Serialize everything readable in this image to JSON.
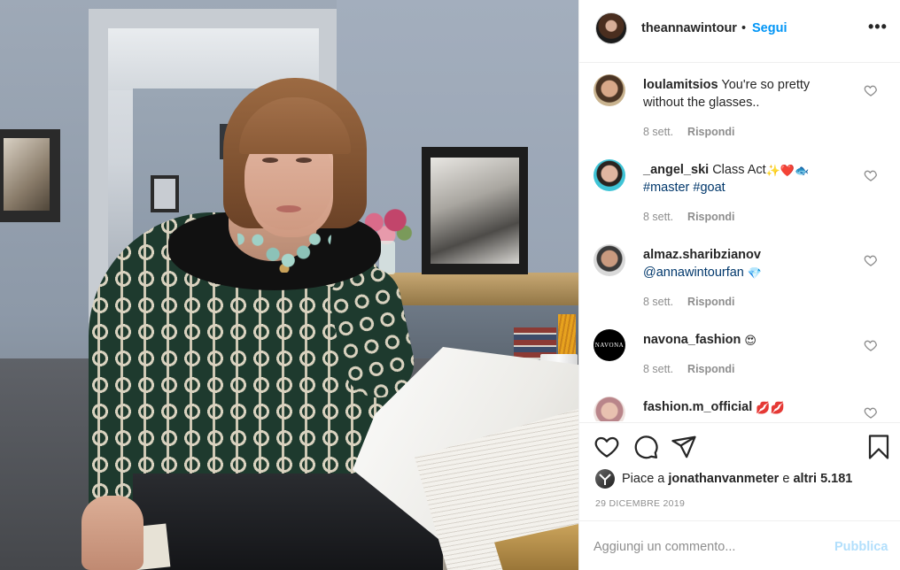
{
  "post": {
    "author": "theannawintour",
    "separator": "•",
    "follow_label": "Segui",
    "more_label": "•••"
  },
  "comments": [
    {
      "user": "loulamitsios",
      "text": "You're so pretty without the glasses..",
      "time": "8 sett.",
      "reply_label": "Rispondi"
    },
    {
      "user": "_angel_ski",
      "text": "Class Act",
      "emojis": "✨❤️🐟",
      "tags": [
        "#master",
        "#goat"
      ],
      "time": "8 sett.",
      "reply_label": "Rispondi"
    },
    {
      "user": "almaz.sharibzianov",
      "mention": "@annawintourfan",
      "emojis": "💎",
      "time": "8 sett.",
      "reply_label": "Rispondi"
    },
    {
      "user": "navona_fashion",
      "emojis": "😍",
      "avatar_text": "NAVONA",
      "time": "8 sett.",
      "reply_label": "Rispondi"
    },
    {
      "user": "fashion.m_official",
      "emojis": "💋💋"
    }
  ],
  "likes": {
    "prefix": "Piace a",
    "user": "jonathanvanmeter",
    "conjunction": "e",
    "others": "altri 5.181"
  },
  "date": "29 DICEMBRE 2019",
  "add_comment": {
    "placeholder": "Aggiungi un commento...",
    "publish_label": "Pubblica"
  },
  "icons": {
    "like": "heart-icon",
    "comment": "comment-icon",
    "share": "paper-plane-icon",
    "save": "bookmark-icon",
    "comment_like": "small-heart-icon",
    "more": "more-options-icon"
  },
  "colors": {
    "accent": "#0095f6",
    "text": "#262626",
    "muted": "#8e8e8e",
    "hashtag": "#00376b",
    "publish_disabled": "#b2dffc",
    "divider": "#efefef"
  }
}
